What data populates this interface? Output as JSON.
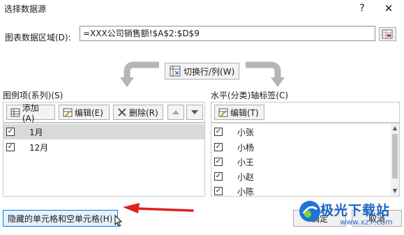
{
  "window": {
    "title": "选择数据源",
    "help": "?",
    "close": "✕"
  },
  "range": {
    "label": "图表数据区域(D):",
    "value": "=XXX公司销售额!$A$2:$D$9"
  },
  "switch_button": "切换行/列(W)",
  "legend": {
    "title": "图例项(系列)(S)",
    "add": "添加(A)",
    "edit": "编辑(E)",
    "delete": "删除(R)",
    "items": [
      {
        "label": "1月",
        "checked": true,
        "selected": true
      },
      {
        "label": "12月",
        "checked": true,
        "selected": false
      }
    ]
  },
  "axis": {
    "title": "水平(分类)轴标签(C)",
    "edit": "编辑(T)",
    "items": [
      {
        "label": "小张",
        "checked": true
      },
      {
        "label": "小杨",
        "checked": true
      },
      {
        "label": "小王",
        "checked": true
      },
      {
        "label": "小赵",
        "checked": true
      },
      {
        "label": "小陈",
        "checked": true
      }
    ]
  },
  "footer": {
    "hidden_cells": "隐藏的单元格和空单元格(H)",
    "ok": "确定",
    "cancel": "取消"
  },
  "watermark": {
    "title": "极光下载站",
    "url": "www.xz7.com"
  },
  "colors": {
    "accent": "#0078d7",
    "annotation_arrow": "#e02020",
    "watermark": "#1c64c8"
  }
}
